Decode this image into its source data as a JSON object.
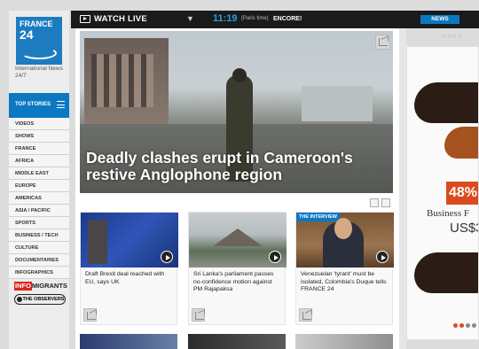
{
  "topbar": {
    "watch_live": "WATCH LIVE",
    "time": "11:19",
    "paris_time": "(Paris time)",
    "encore": "ENCORE!",
    "news_button": "NEWS"
  },
  "sidebar": {
    "logo_line1": "FRANCE",
    "logo_line2": "24",
    "tagline": "International News 24/7",
    "top_stories": "TOP STORIES",
    "items": [
      "VIDEOS",
      "SHOWS",
      "FRANCE",
      "AFRICA",
      "MIDDLE EAST",
      "EUROPE",
      "AMERICAS",
      "ASIA / PACIFIC",
      "SPORTS",
      "BUSINESS / TECH",
      "CULTURE",
      "DOCUMENTARIES",
      "INFOGRAPHICS"
    ],
    "info_migrants_a": "INFO",
    "info_migrants_b": "MIGRANTS",
    "observers": "THE OBSERVERS"
  },
  "hero": {
    "title": "Deadly clashes erupt in Cameroon's restive Anglophone region"
  },
  "cards": [
    {
      "caption": "Draft Brexit deal reached with EU, says UK",
      "badge": ""
    },
    {
      "caption": "Sri Lanka's parliament passes no-confidence motion against PM Rajapaksa",
      "badge": ""
    },
    {
      "caption": "Venezuelan 'tyrant' must be isolated, Colombia's Duque tells FRANCE 24",
      "badge": "THE INTERVIEW"
    }
  ],
  "ad": {
    "percent": "48%",
    "business": "Business F",
    "price": "US$3",
    "accent": "#d94b1f"
  },
  "colors": {
    "brand_blue": "#0a78c2",
    "topbar": "#1a1a1a"
  }
}
